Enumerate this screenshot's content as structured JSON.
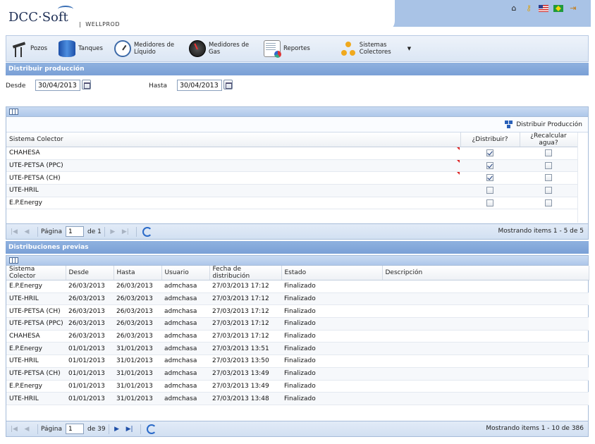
{
  "header": {
    "logo_text": "DCC·Soft",
    "brand": "WELLPROD",
    "icons": [
      "home-icon",
      "key-icon",
      "flag-us-icon",
      "flag-br-icon",
      "logout-icon"
    ]
  },
  "toolbar": {
    "items": [
      {
        "label": "Pozos",
        "icon": "pump-jack-icon"
      },
      {
        "label": "Tanques",
        "icon": "tank-icon"
      },
      {
        "label": "Medidores de Líquido",
        "icon": "liquid-meter-icon"
      },
      {
        "label": "Medidores de Gas",
        "icon": "gas-meter-icon"
      },
      {
        "label": "Reportes",
        "icon": "report-icon"
      },
      {
        "label": "Sistemas Colectores",
        "icon": "collector-systems-icon"
      }
    ]
  },
  "distribuir": {
    "title": "Distribuir producción",
    "desde_label": "Desde",
    "desde_value": "30/04/2013",
    "hasta_label": "Hasta",
    "hasta_value": "30/04/2013"
  },
  "grid1": {
    "action_label": "Distribuir Producción",
    "columns": [
      "Sistema Colector",
      "¿Distribuir?",
      "¿Recalcular agua?"
    ],
    "rows": [
      {
        "sistema": "CHAHESA",
        "distribuir": true,
        "recalcular": false
      },
      {
        "sistema": "UTE-PETSA (PPC)",
        "distribuir": true,
        "recalcular": false
      },
      {
        "sistema": "UTE-PETSA (CH)",
        "distribuir": true,
        "recalcular": false
      },
      {
        "sistema": "UTE-HRIL",
        "distribuir": false,
        "recalcular": false
      },
      {
        "sistema": "E.P.Energy",
        "distribuir": false,
        "recalcular": false
      }
    ],
    "pager": {
      "page_label": "Página",
      "page_value": "1",
      "of_label": "de 1",
      "info": "Mostrando items 1 - 5 de 5"
    }
  },
  "previas": {
    "title": "Distribuciones previas",
    "columns": [
      "Sistema Colector",
      "Desde",
      "Hasta",
      "Usuario",
      "Fecha de distribución",
      "Estado",
      "Descripción"
    ],
    "rows": [
      [
        "E.P.Energy",
        "26/03/2013",
        "26/03/2013",
        "admchasa",
        "27/03/2013 17:12",
        "Finalizado",
        ""
      ],
      [
        "UTE-HRIL",
        "26/03/2013",
        "26/03/2013",
        "admchasa",
        "27/03/2013 17:12",
        "Finalizado",
        ""
      ],
      [
        "UTE-PETSA (CH)",
        "26/03/2013",
        "26/03/2013",
        "admchasa",
        "27/03/2013 17:12",
        "Finalizado",
        ""
      ],
      [
        "UTE-PETSA (PPC)",
        "26/03/2013",
        "26/03/2013",
        "admchasa",
        "27/03/2013 17:12",
        "Finalizado",
        ""
      ],
      [
        "CHAHESA",
        "26/03/2013",
        "26/03/2013",
        "admchasa",
        "27/03/2013 17:12",
        "Finalizado",
        ""
      ],
      [
        "E.P.Energy",
        "01/01/2013",
        "31/01/2013",
        "admchasa",
        "27/03/2013 13:51",
        "Finalizado",
        ""
      ],
      [
        "UTE-HRIL",
        "01/01/2013",
        "31/01/2013",
        "admchasa",
        "27/03/2013 13:50",
        "Finalizado",
        ""
      ],
      [
        "UTE-PETSA (CH)",
        "01/01/2013",
        "31/01/2013",
        "admchasa",
        "27/03/2013 13:49",
        "Finalizado",
        ""
      ],
      [
        "E.P.Energy",
        "01/01/2013",
        "31/01/2013",
        "admchasa",
        "27/03/2013 13:49",
        "Finalizado",
        ""
      ],
      [
        "UTE-HRIL",
        "01/01/2013",
        "31/01/2013",
        "admchasa",
        "27/03/2013 13:48",
        "Finalizado",
        ""
      ]
    ],
    "pager": {
      "page_label": "Página",
      "page_value": "1",
      "of_label": "de 39",
      "info": "Mostrando items 1 - 10 de 386"
    }
  }
}
